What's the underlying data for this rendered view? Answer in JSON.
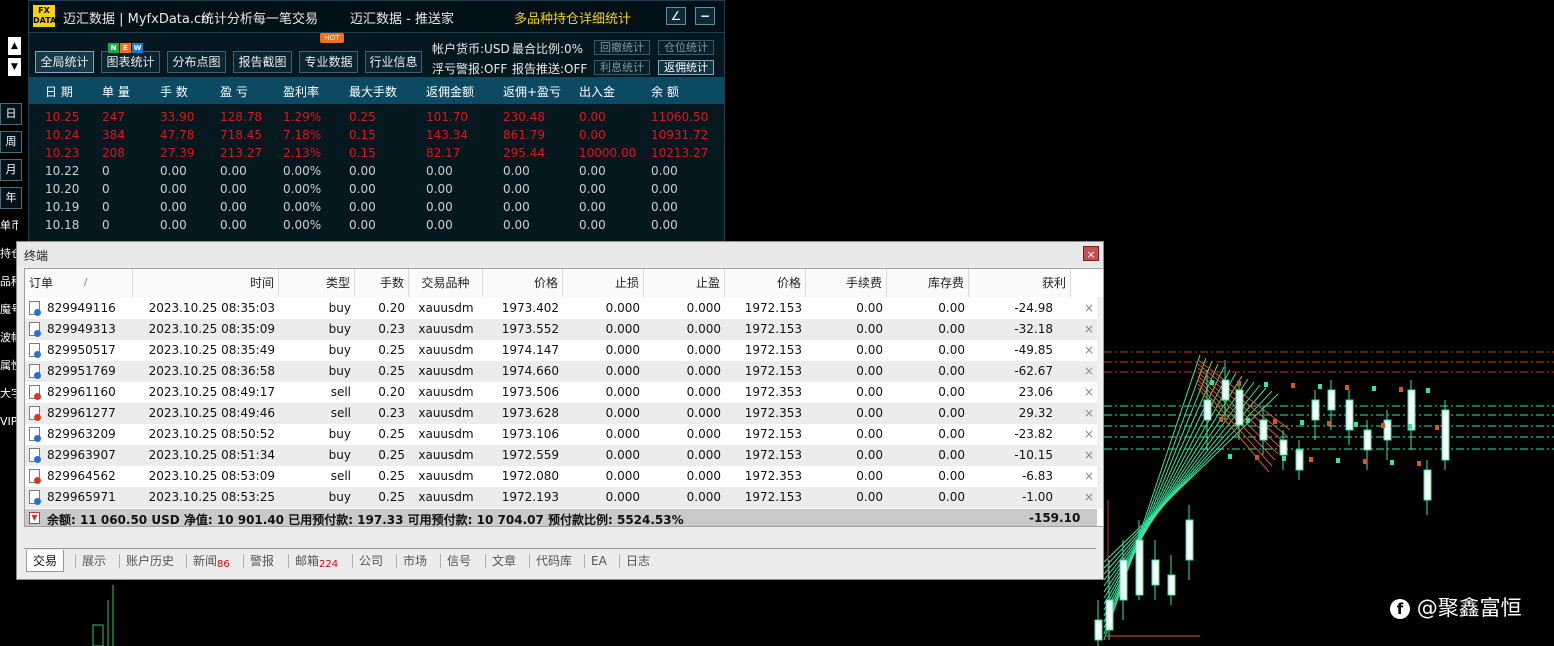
{
  "stats_panel": {
    "logo_top": "FX",
    "logo_bottom": "DATA",
    "app_title": "迈汇数据 | MyfxData.cn",
    "app_slogan": "统计分析每一笔交易",
    "center_title": "迈汇数据 - 推送家",
    "highlight_title": "多品种持仓详细统计",
    "colors": {
      "accent": "#f5d20a",
      "header_bg": "#0b4a62",
      "profit_red": "#e01515"
    },
    "nav_buttons": [
      "全局统计",
      "图表统计",
      "分布点图",
      "报告截图",
      "专业数据",
      "行业信息"
    ],
    "badge_new": [
      "N",
      "E",
      "W"
    ],
    "badge_hot": "HOT",
    "info": {
      "currency": "帐户货币:USD",
      "margin_ratio": "最合比例:0%",
      "float_alert": "浮亏警报:OFF",
      "report_push": "报告推送:OFF"
    },
    "small_buttons": [
      "回撤统计",
      "仓位统计",
      "利息统计",
      "返佣统计"
    ],
    "columns": [
      "日 期",
      "单 量",
      "手 数",
      "盈 亏",
      "盈利率",
      "最大手数",
      "返佣金额",
      "返佣+盈亏",
      "出入金",
      "余 额"
    ],
    "rows": [
      [
        "10.25",
        "247",
        "33.90",
        "128.78",
        "1.29%",
        "0.25",
        "101.70",
        "230.48",
        "0.00",
        "11060.50"
      ],
      [
        "10.24",
        "384",
        "47.78",
        "718.45",
        "7.18%",
        "0.15",
        "143.34",
        "861.79",
        "0.00",
        "10931.72"
      ],
      [
        "10.23",
        "208",
        "27.39",
        "213.27",
        "2.13%",
        "0.15",
        "82.17",
        "295.44",
        "10000.00",
        "10213.27"
      ],
      [
        "10.22",
        "0",
        "0.00",
        "0.00",
        "0.00%",
        "0.00",
        "0.00",
        "0.00",
        "0.00",
        "0.00"
      ],
      [
        "10.20",
        "0",
        "0.00",
        "0.00",
        "0.00%",
        "0.00",
        "0.00",
        "0.00",
        "0.00",
        "0.00"
      ],
      [
        "10.19",
        "0",
        "0.00",
        "0.00",
        "0.00%",
        "0.00",
        "0.00",
        "0.00",
        "0.00",
        "0.00"
      ],
      [
        "10.18",
        "0",
        "0.00",
        "0.00",
        "0.00%",
        "0.00",
        "0.00",
        "0.00",
        "0.00",
        "0.00"
      ]
    ],
    "side_tabs": [
      "日",
      "周",
      "月",
      "年"
    ],
    "side_labels": [
      "单币",
      "持仓",
      "品种",
      "魔号",
      "波幅",
      "属性",
      "大字",
      "VIP"
    ]
  },
  "terminal": {
    "title": "终端",
    "columns": [
      "订单",
      "时间",
      "类型",
      "手数",
      "交易品种",
      "价格",
      "止损",
      "止盈",
      "价格",
      "手续费",
      "库存费",
      "获利"
    ],
    "orders": [
      [
        "829949116",
        "2023.10.25 08:35:03",
        "buy",
        "0.20",
        "xauusdm",
        "1973.402",
        "0.000",
        "0.000",
        "1972.153",
        "0.00",
        "0.00",
        "-24.98"
      ],
      [
        "829949313",
        "2023.10.25 08:35:09",
        "buy",
        "0.23",
        "xauusdm",
        "1973.552",
        "0.000",
        "0.000",
        "1972.153",
        "0.00",
        "0.00",
        "-32.18"
      ],
      [
        "829950517",
        "2023.10.25 08:35:49",
        "buy",
        "0.25",
        "xauusdm",
        "1974.147",
        "0.000",
        "0.000",
        "1972.153",
        "0.00",
        "0.00",
        "-49.85"
      ],
      [
        "829951769",
        "2023.10.25 08:36:58",
        "buy",
        "0.25",
        "xauusdm",
        "1974.660",
        "0.000",
        "0.000",
        "1972.153",
        "0.00",
        "0.00",
        "-62.67"
      ],
      [
        "829961160",
        "2023.10.25 08:49:17",
        "sell",
        "0.20",
        "xauusdm",
        "1973.506",
        "0.000",
        "0.000",
        "1972.353",
        "0.00",
        "0.00",
        "23.06"
      ],
      [
        "829961277",
        "2023.10.25 08:49:46",
        "sell",
        "0.23",
        "xauusdm",
        "1973.628",
        "0.000",
        "0.000",
        "1972.353",
        "0.00",
        "0.00",
        "29.32"
      ],
      [
        "829963209",
        "2023.10.25 08:50:52",
        "buy",
        "0.25",
        "xauusdm",
        "1973.106",
        "0.000",
        "0.000",
        "1972.153",
        "0.00",
        "0.00",
        "-23.82"
      ],
      [
        "829963907",
        "2023.10.25 08:51:34",
        "buy",
        "0.25",
        "xauusdm",
        "1972.559",
        "0.000",
        "0.000",
        "1972.153",
        "0.00",
        "0.00",
        "-10.15"
      ],
      [
        "829964562",
        "2023.10.25 08:53:09",
        "sell",
        "0.25",
        "xauusdm",
        "1972.080",
        "0.000",
        "0.000",
        "1972.353",
        "0.00",
        "0.00",
        "-6.83"
      ],
      [
        "829965971",
        "2023.10.25 08:53:25",
        "buy",
        "0.25",
        "xauusdm",
        "1972.193",
        "0.000",
        "0.000",
        "1972.153",
        "0.00",
        "0.00",
        "-1.00"
      ]
    ],
    "summary_text": "余额: 11 060.50 USD  净值: 10 901.40  已用预付款: 197.33  可用预付款: 10 704.07  预付款比例: 5524.53%",
    "summary_total": "-159.10",
    "tabs": [
      {
        "label": "交易",
        "badge": ""
      },
      {
        "label": "展示",
        "badge": ""
      },
      {
        "label": "账户历史",
        "badge": ""
      },
      {
        "label": "新闻",
        "badge": "86"
      },
      {
        "label": "警报",
        "badge": ""
      },
      {
        "label": "邮箱",
        "badge": "224"
      },
      {
        "label": "公司",
        "badge": ""
      },
      {
        "label": "市场",
        "badge": ""
      },
      {
        "label": "信号",
        "badge": ""
      },
      {
        "label": "文章",
        "badge": ""
      },
      {
        "label": "代码库",
        "badge": ""
      },
      {
        "label": "EA",
        "badge": ""
      },
      {
        "label": "日志",
        "badge": ""
      }
    ]
  },
  "watermark": "@聚鑫富恒"
}
